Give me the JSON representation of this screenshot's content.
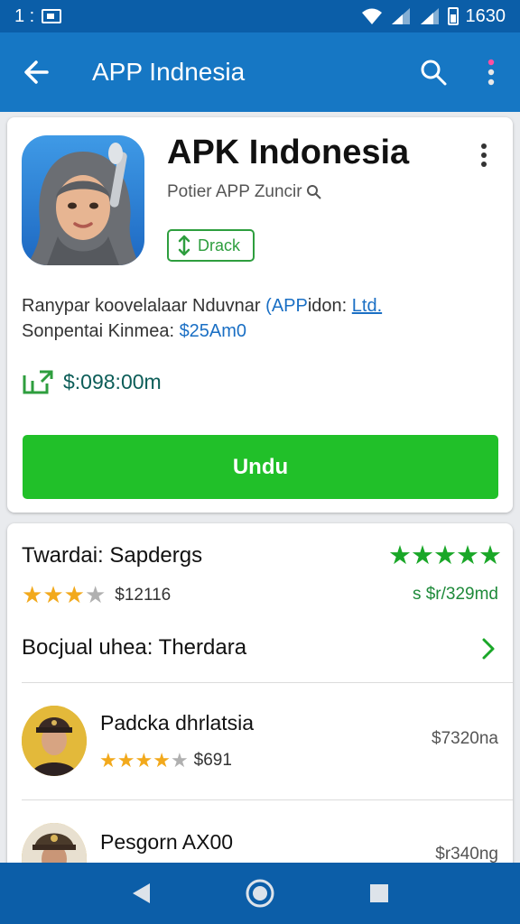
{
  "status_bar": {
    "time_left": "1 :",
    "time_right": "1630"
  },
  "app_bar": {
    "title": "APP Indnesia"
  },
  "app": {
    "name": "APK Indonesia",
    "developer": "Potier APP Zuncir",
    "install_chip": "Drack",
    "desc_line1_a": "Ranypar koovelalaar Nduvnar ",
    "desc_line1_link": "(APP",
    "desc_line1_b": "idon: ",
    "desc_line1_u": "Ltd.",
    "desc_line2_a": "Sonpentai Kinmea: ",
    "desc_line2_link": "$25Am0",
    "price": "$:098:00m",
    "download_label": "Undu"
  },
  "reviews": {
    "title": "Twardai: Sapdergs",
    "big_rating_stars": 5,
    "small_rating": {
      "filled": 3,
      "total": 4
    },
    "small_value": "$12116",
    "right_value": "s $r/329md",
    "see_all_label": "Bocjual uhea: Therdara",
    "items": [
      {
        "name": "Padcka dhrlatsia",
        "value": "$7320na",
        "rating": 4,
        "rating_total": 5,
        "score": "$691"
      },
      {
        "name": "Pesgorn AX00",
        "value": "$r340ng"
      }
    ]
  },
  "colors": {
    "status_bar": "#0b5ea8",
    "app_bar": "#1677c4",
    "download_button": "#21c029",
    "accent_green": "#2e9e3e",
    "link_blue": "#1a6fc4",
    "nav_bar": "#0c5ea8"
  }
}
